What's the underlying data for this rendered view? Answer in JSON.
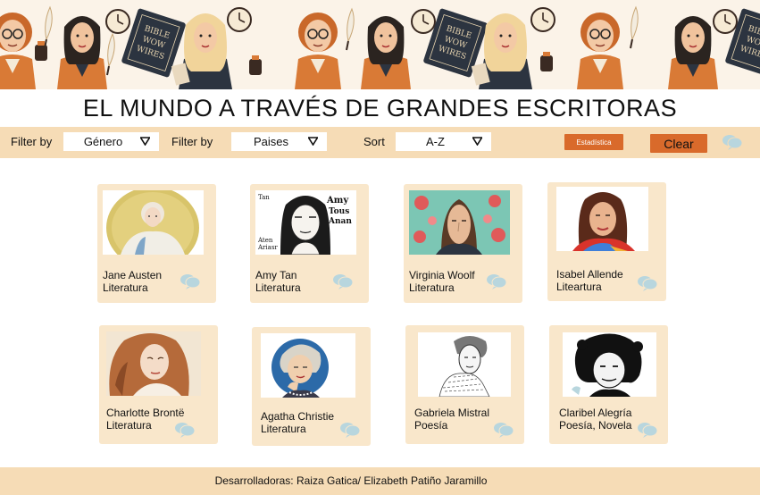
{
  "title": "EL MUNDO A TRAVÉS DE GRANDES ESCRITORAS",
  "banner": {
    "book_text": [
      "BIBLE",
      "WOW",
      "WIRES"
    ]
  },
  "toolbar": {
    "filter1_label": "Filter by",
    "filter1_value": "Género",
    "filter2_label": "Filter by",
    "filter2_value": "Paises",
    "sort_label": "Sort",
    "sort_value": "A-Z",
    "stats_label": "Estadística",
    "clear_label": "Clear"
  },
  "cards": [
    {
      "name": "Jane Austen",
      "genre": "Literatura",
      "portrait": "jane-austen-portrait"
    },
    {
      "name": "Amy Tan",
      "genre": "Literatura",
      "portrait": "amy-tan-portrait",
      "photo_text": [
        "Tan",
        "Amy",
        "Tous",
        "Anan",
        "Aten",
        "Ariasr"
      ]
    },
    {
      "name": "Virginia Woolf",
      "genre": "Literatura",
      "portrait": "virginia-woolf-portrait"
    },
    {
      "name": "Isabel Allende",
      "genre": "Liteartura",
      "portrait": "isabel-allende-portrait"
    },
    {
      "name": "Charlotte Brontë",
      "genre": "Literatura",
      "portrait": "charlotte-bronte-portrait"
    },
    {
      "name": "Agatha Christie",
      "genre": "Literatura",
      "portrait": "agatha-christie-portrait"
    },
    {
      "name": "Gabriela Mistral",
      "genre": "Poesía",
      "portrait": "gabriela-mistral-portrait"
    },
    {
      "name": "Claribel Alegría",
      "genre": "Poesía, Novela",
      "portrait": "claribel-alegria-portrait"
    }
  ],
  "footer": {
    "text": "Desarrolladoras: Raiza Gatica/ Elizabeth Patiño Jaramillo"
  },
  "colors": {
    "accent": "#d96a2b",
    "toolbar": "#f6dcb6",
    "card": "#f9e7cb",
    "chat": "#b8d6de"
  }
}
